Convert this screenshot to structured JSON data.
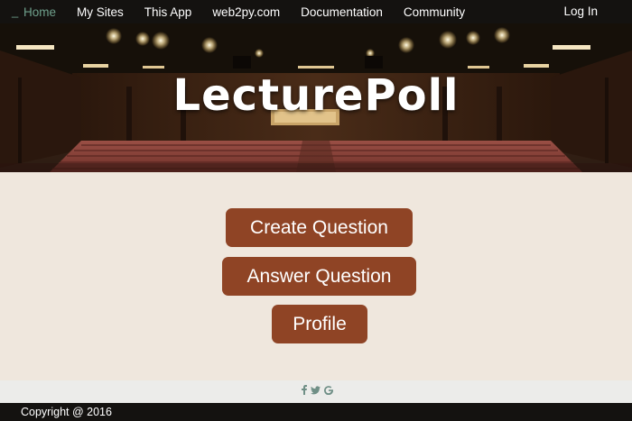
{
  "nav": {
    "brand": "_",
    "items": [
      {
        "label": "Home",
        "active": true
      },
      {
        "label": "My Sites",
        "active": false
      },
      {
        "label": "This App",
        "active": false
      },
      {
        "label": "web2py.com",
        "active": false
      },
      {
        "label": "Documentation",
        "active": false
      },
      {
        "label": "Community",
        "active": false
      }
    ],
    "login": "Log In"
  },
  "hero": {
    "title": "LecturePoll",
    "image": "lecture-hall-photo"
  },
  "actions": {
    "create": "Create Question",
    "answer": "Answer Question",
    "profile": "Profile"
  },
  "social": {
    "icons": [
      "facebook-icon",
      "twitter-icon",
      "google-icon"
    ]
  },
  "footer": {
    "copyright": "Copyright @ 2016"
  },
  "colors": {
    "nav_bg": "#141210",
    "nav_active": "#6fa08c",
    "button": "#8f4425",
    "page_bg": "#efe7dd",
    "social_bar": "#ececea",
    "social_icon": "#6f8f86"
  }
}
